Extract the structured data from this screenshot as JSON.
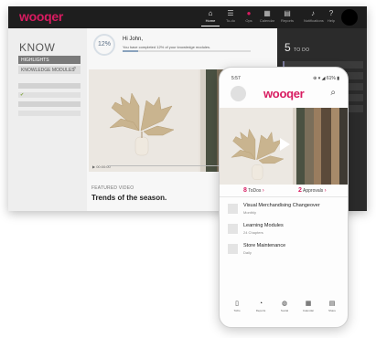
{
  "colors": {
    "brand": "#d81b60",
    "topbar": "#1e1e1e",
    "todo_panel": "#2b2b2b"
  },
  "desktop": {
    "logo": "wooqer",
    "nav": [
      {
        "label": "Home",
        "icon": "home-icon",
        "glyph": "⌂",
        "active": true
      },
      {
        "label": "To-do",
        "icon": "list-icon",
        "glyph": "☰",
        "active": false
      },
      {
        "label": "Ops",
        "icon": "alert-icon",
        "glyph": "●",
        "active": false
      },
      {
        "label": "Calendar",
        "icon": "calendar-icon",
        "glyph": "▦",
        "active": false
      },
      {
        "label": "Reports",
        "icon": "reports-icon",
        "glyph": "▤",
        "active": false
      },
      {
        "label": "Notifications",
        "icon": "bell-icon",
        "glyph": "♪",
        "active": false
      },
      {
        "label": "Help",
        "icon": "help-icon",
        "glyph": "?",
        "active": false
      }
    ],
    "left": {
      "title": "KNOW",
      "tab_highlights": "HIGHLIGHTS",
      "tab_modules": "KNOWLEDGE MODULES"
    },
    "greeting": "Hi John,",
    "progress_percent": "12%",
    "progress_fraction": 0.12,
    "progress_text": "You have completed 12% of your knowledge modules.",
    "video_time": "▶  00:00:00",
    "featured_label": "FEATURED VIDEO",
    "featured_title": "Trends of the season.",
    "todo_count": "5",
    "todo_label": "TO DO"
  },
  "phone": {
    "time": "5:57",
    "status_icons": "⊕ ▾ ◢ 61% ▮",
    "logo": "wooqer",
    "todo_count": "8",
    "todo_label": "ToDos",
    "approvals_count": "2",
    "approvals_label": "Approvals",
    "items": [
      {
        "title": "Visual Merchandising Changeover",
        "sub": "Monthly"
      },
      {
        "title": "Learning Modules",
        "sub": "24 Chapters"
      },
      {
        "title": "Store Maintenance",
        "sub": "Daily"
      }
    ],
    "nav": [
      {
        "label": "ToDo",
        "icon": "document-icon",
        "glyph": "▯"
      },
      {
        "label": "Reports",
        "icon": "pie-chart-icon",
        "glyph": "◔"
      },
      {
        "label": "Social",
        "icon": "chat-icon",
        "glyph": "◍"
      },
      {
        "label": "Calendar",
        "icon": "calendar-icon",
        "glyph": "▦"
      },
      {
        "label": "Share",
        "icon": "share-icon",
        "glyph": "▤"
      }
    ]
  }
}
